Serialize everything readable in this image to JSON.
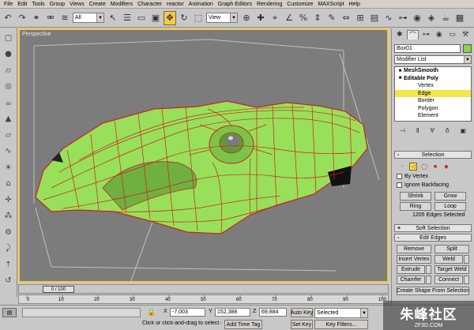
{
  "menu": [
    "File",
    "Edit",
    "Tools",
    "Group",
    "Views",
    "Create",
    "Modifiers",
    "Character",
    "reactor",
    "Animation",
    "Graph Editors",
    "Rendering",
    "Customize",
    "MAXScript",
    "Help"
  ],
  "toolbar": {
    "selection_filter": "All",
    "reference_coord": "View"
  },
  "viewport": {
    "label": "Perspective"
  },
  "timeslider": {
    "frame": "0 / 100"
  },
  "ruler": {
    "ticks": [
      "0",
      "10",
      "20",
      "30",
      "40",
      "50",
      "60",
      "70",
      "80",
      "90",
      "100"
    ]
  },
  "status": {
    "x_label": "X",
    "x_value": "-7,003",
    "y_label": "Y",
    "y_value": "152,388",
    "z_label": "Z",
    "z_value": "69,884",
    "prompt": "Click or click-and-drag to select obj",
    "add_time_tag": "Add Time Tag",
    "auto_key": "Auto Key",
    "set_key": "Set Key",
    "key_mode": "Selected",
    "key_filters": "Key Filters..."
  },
  "command_panel": {
    "object_name": "Box01",
    "modifier_list": "Modifier List",
    "object_color": "#8ad04a",
    "stack": [
      {
        "label": "MeshSmooth",
        "level": 0,
        "bold": true,
        "selected": false
      },
      {
        "label": "Editable Poly",
        "level": 0,
        "bold": true,
        "selected": false
      },
      {
        "label": "Vertex",
        "level": 1,
        "bold": false,
        "selected": false
      },
      {
        "label": "Edge",
        "level": 1,
        "bold": false,
        "selected": true
      },
      {
        "label": "Border",
        "level": 1,
        "bold": false,
        "selected": false
      },
      {
        "label": "Polygon",
        "level": 1,
        "bold": false,
        "selected": false
      },
      {
        "label": "Element",
        "level": 1,
        "bold": false,
        "selected": false
      }
    ],
    "selection_rollout": "Selection",
    "by_vertex": "By Vertex",
    "ignore_backfacing": "Ignore Backfacing",
    "shrink": "Shrink",
    "grow": "Grow",
    "ring": "Ring",
    "loop": "Loop",
    "selected_count": "1205 Edges Selected",
    "soft_selection_rollout": "Soft Selection",
    "edit_edges_rollout": "Edit Edges",
    "remove": "Remove",
    "split": "Split",
    "insert_vertex": "Insert Vertex",
    "weld": "Weld",
    "extrude": "Extrude",
    "target_weld": "Target Weld",
    "chamfer": "Chamfer",
    "connect": "Connect",
    "create_shape": "Create Shape From Selection"
  },
  "watermark": {
    "title": "朱峰社区",
    "url": "ZF3D.COM"
  }
}
